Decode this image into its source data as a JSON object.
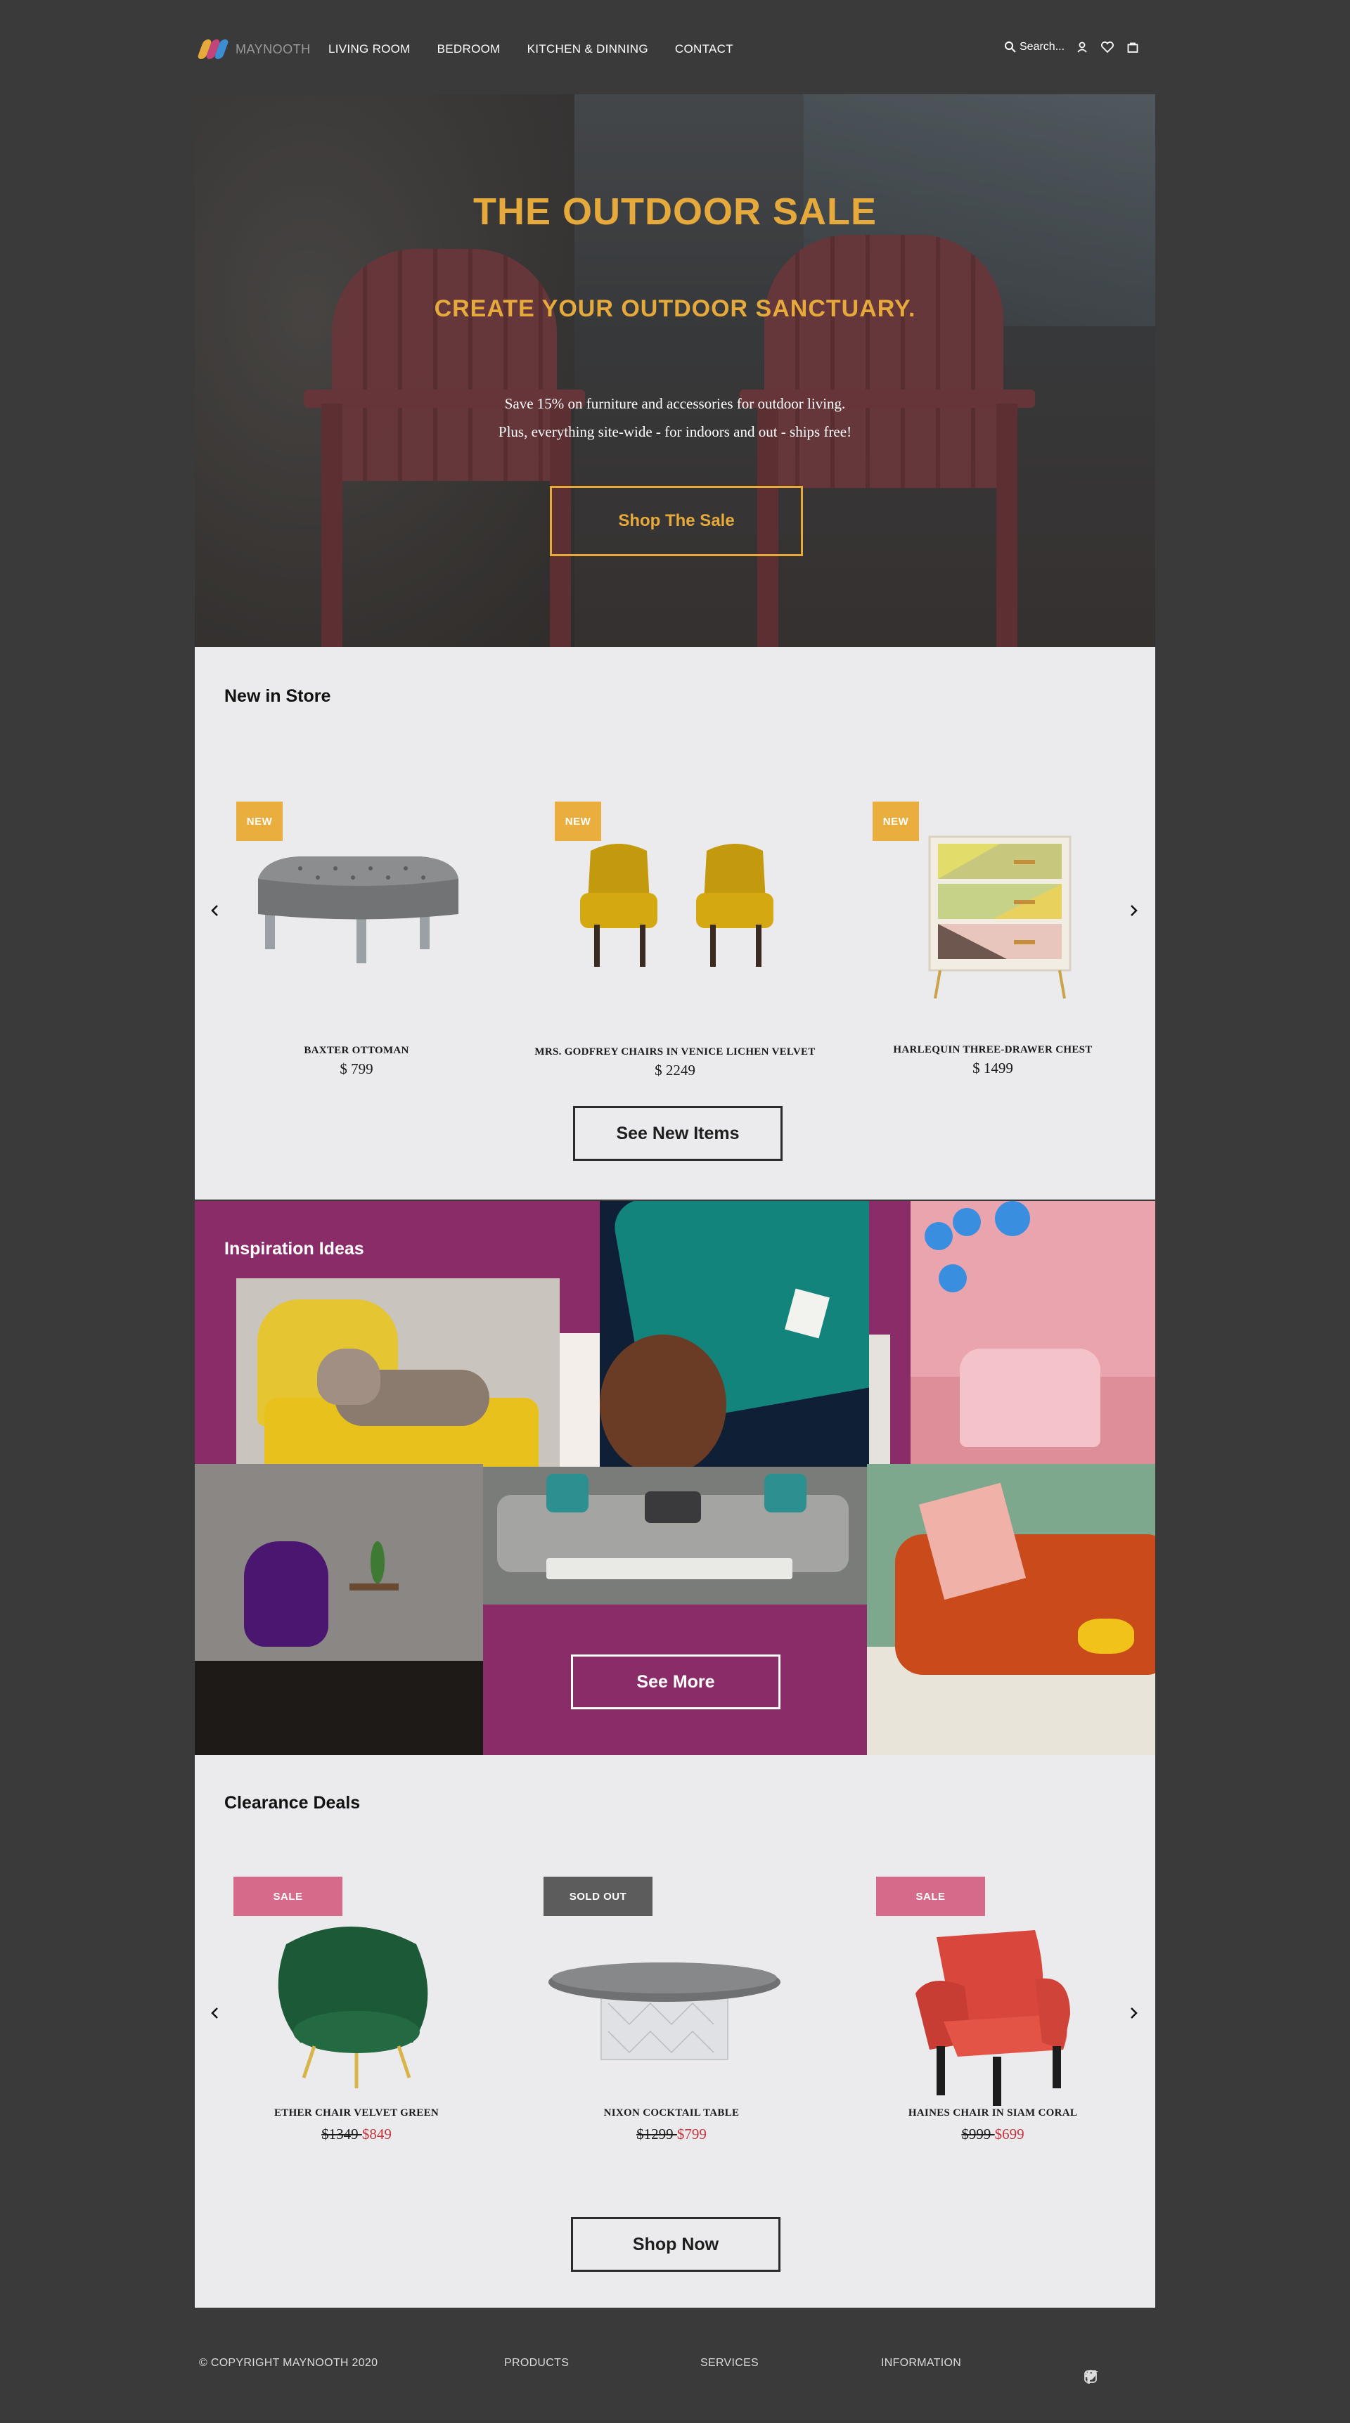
{
  "header": {
    "brand": "MAYNOOTH",
    "nav": [
      "LIVING ROOM",
      "BEDROOM",
      "KITCHEN & DINNING",
      "CONTACT"
    ],
    "search_placeholder": "Search..."
  },
  "hero": {
    "title": "THE OUTDOOR SALE",
    "subtitle": "CREATE YOUR OUTDOOR SANCTUARY.",
    "line1": "Save 15% on furniture  and accessories for outdoor living.",
    "line2": "Plus, everything site-wide - for indoors and out - ships free!",
    "cta": "Shop The Sale"
  },
  "new_in_store": {
    "title": "New in Store",
    "items": [
      {
        "badge": "NEW",
        "name": "BAXTER OTTOMAN",
        "price": "$ 799"
      },
      {
        "badge": "NEW",
        "name": "MRS. GODFREY CHAIRS IN VENICE LICHEN VELVET",
        "price": "$ 2249"
      },
      {
        "badge": "NEW",
        "name": "HARLEQUIN THREE-DRAWER CHEST",
        "price": "$ 1499"
      }
    ],
    "cta": "See New Items"
  },
  "inspiration": {
    "title": "Inspiration Ideas",
    "cta": "See More"
  },
  "clearance": {
    "title": "Clearance Deals",
    "items": [
      {
        "badge": "SALE",
        "name": "ETHER CHAIR VELVET GREEN",
        "old_price": "$1349 ",
        "new_price": "$849"
      },
      {
        "badge": "SOLD OUT",
        "name": "NIXON COCKTAIL TABLE",
        "old_price": "$1299 ",
        "new_price": "$799"
      },
      {
        "badge": "SALE",
        "name": "HAINES CHAIR IN SIAM CORAL",
        "old_price": "$999 ",
        "new_price": "$699"
      }
    ],
    "cta": "Shop Now"
  },
  "footer": {
    "copyright": "© COPYRIGHT MAYNOOTH 2020",
    "links": [
      "PRODUCTS",
      "SERVICES",
      "INFORMATION"
    ]
  },
  "colors": {
    "accent_gold": "#e6a93b",
    "plum": "#8a2c68",
    "badge_new": "#e9ae3e",
    "badge_sale": "#d66a8a",
    "badge_soldout": "#5c5c5c",
    "sale_price": "#c8343b"
  },
  "icons": [
    "search-icon",
    "user-icon",
    "heart-icon",
    "bag-icon",
    "instagram-icon",
    "twitter-icon",
    "facebook-icon",
    "chevron-left-icon",
    "chevron-right-icon"
  ]
}
